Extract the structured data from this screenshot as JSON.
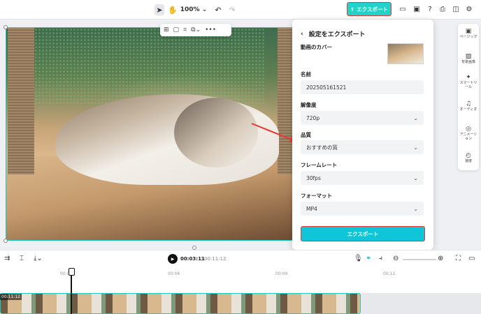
{
  "topbar": {
    "zoom": "100%",
    "export_label": "エクスポート"
  },
  "panel": {
    "title": "設定をエクスポート",
    "cover_label": "動画のカバー",
    "name_label": "名前",
    "name_value": "202505161521",
    "resolution_label": "解像度",
    "resolution_value": "720p",
    "quality_label": "品質",
    "quality_value": "おすすめの質",
    "framerate_label": "フレームレート",
    "framerate_value": "30fps",
    "format_label": "フォーマット",
    "format_value": "MP4",
    "export_button": "エクスポート"
  },
  "sidebar": {
    "items": [
      {
        "label": "ページック",
        "icon": "page-icon"
      },
      {
        "label": "背景画像",
        "icon": "background-icon"
      },
      {
        "label": "スマートツール",
        "icon": "smart-tool-icon"
      },
      {
        "label": "オーディオ",
        "icon": "audio-icon"
      },
      {
        "label": "アニメーション",
        "icon": "animation-icon"
      },
      {
        "label": "速度",
        "icon": "speed-icon"
      }
    ]
  },
  "timeline": {
    "current_time": "00:03:11",
    "separator": "|",
    "total_time": "00:11:12",
    "ruler": [
      "00:03",
      "00:06",
      "00:09",
      "00:12"
    ],
    "clip_duration": "00:11:12"
  }
}
